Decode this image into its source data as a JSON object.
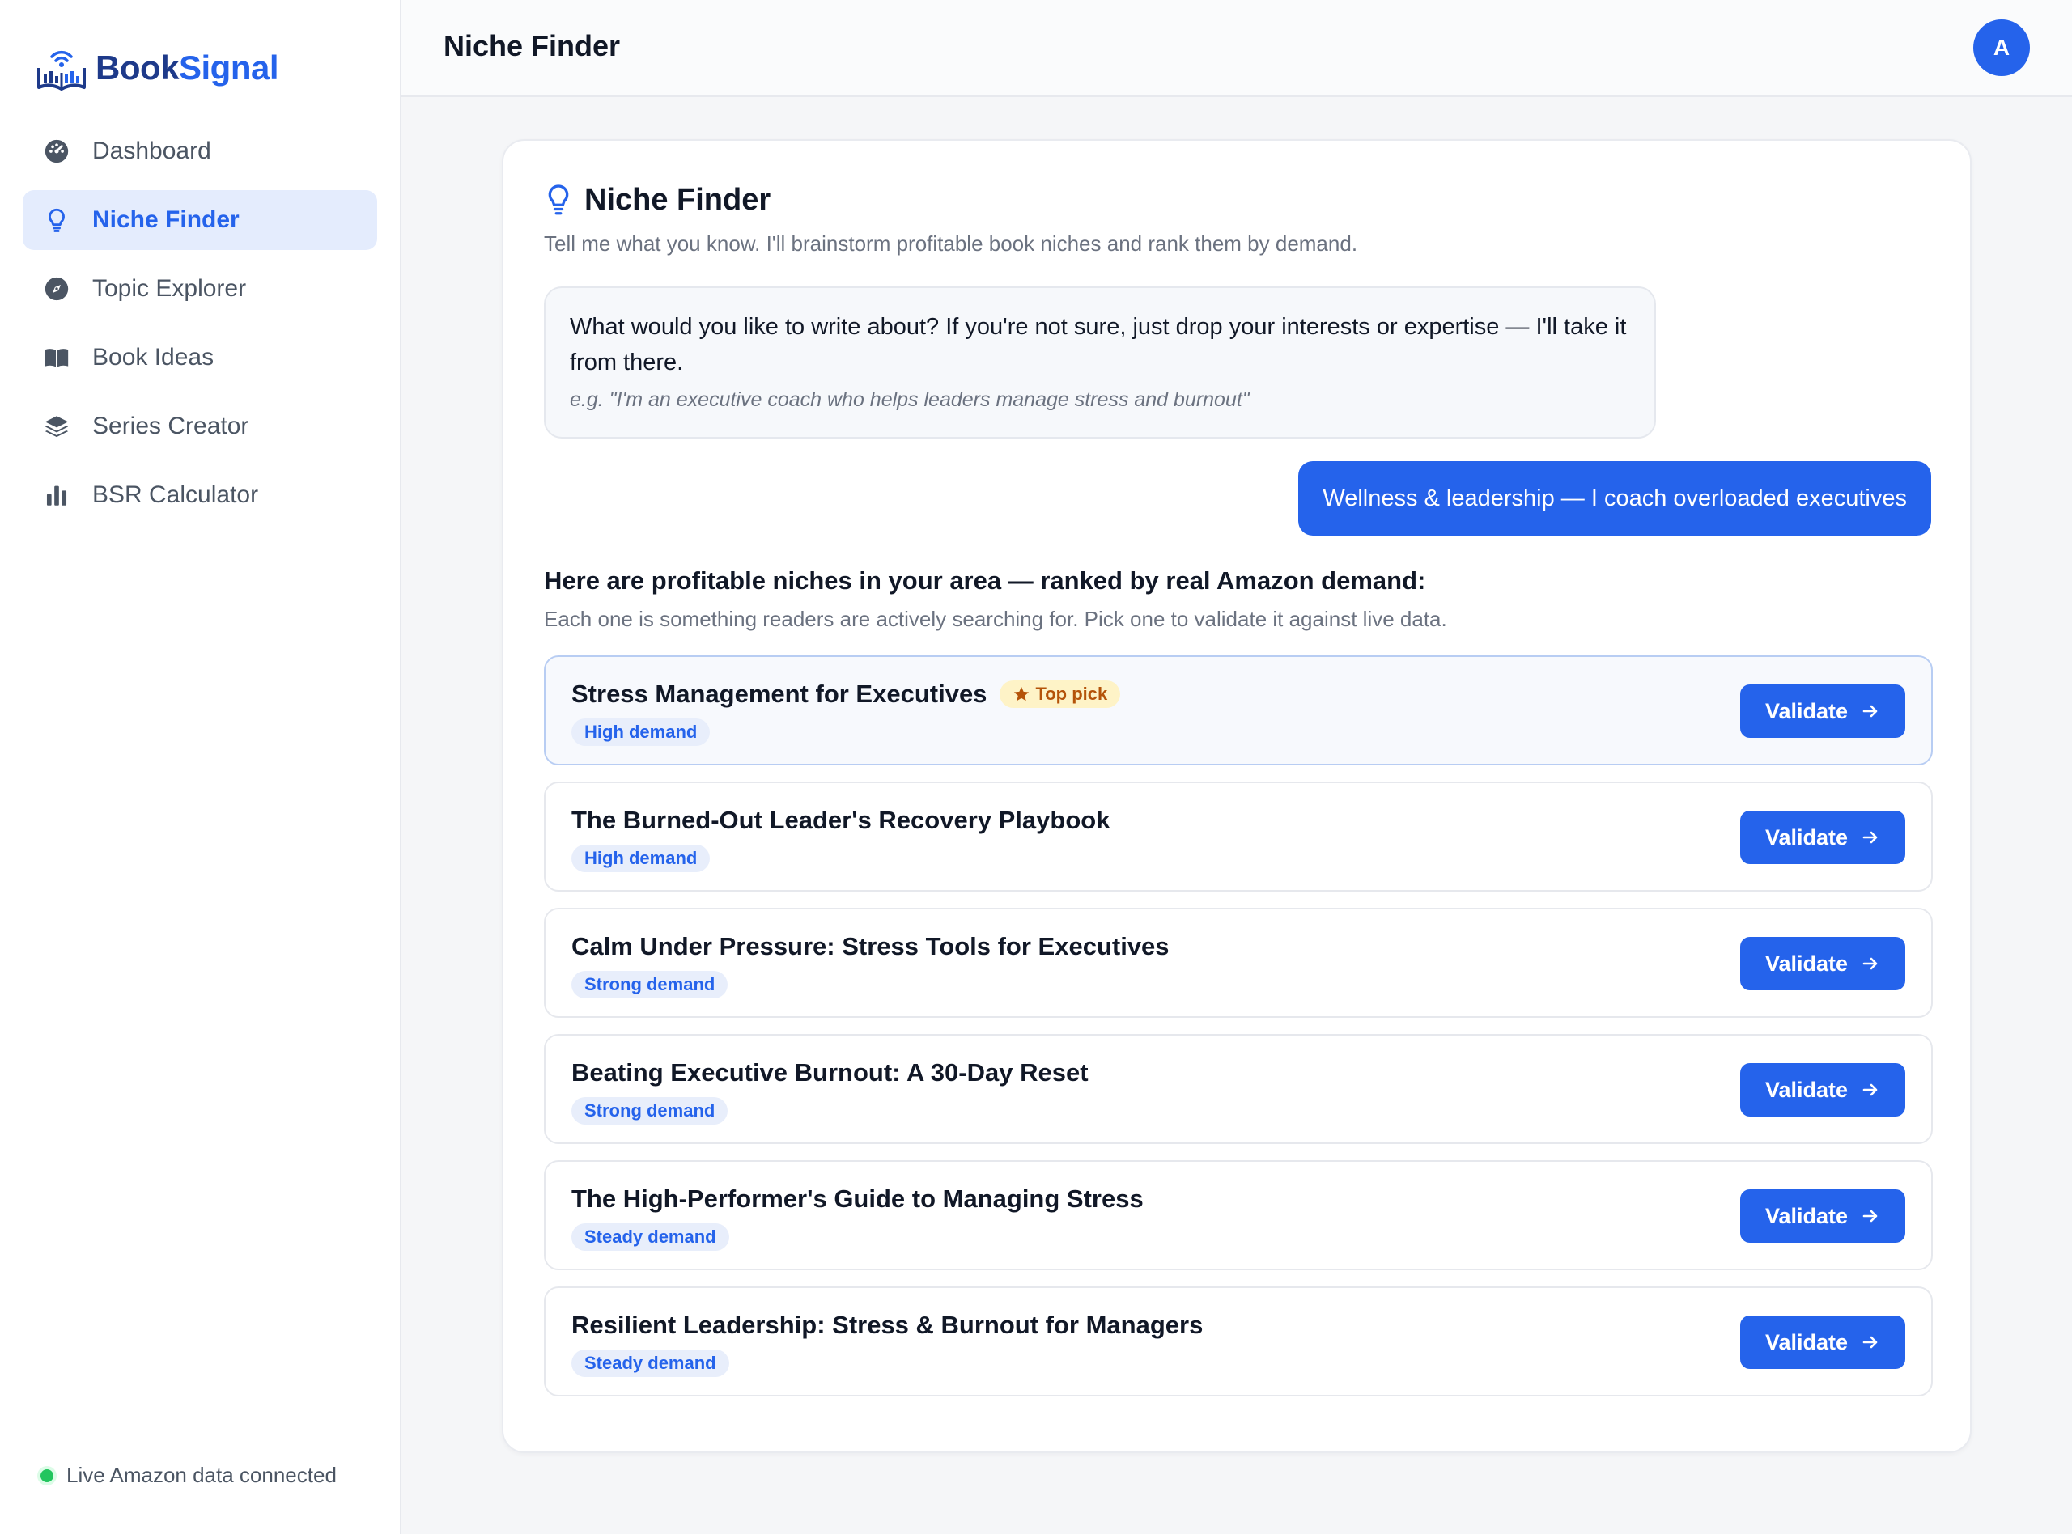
{
  "brand": {
    "part1": "Book",
    "part2": "Signal"
  },
  "sidebar": {
    "items": [
      {
        "label": "Dashboard",
        "icon": "gauge-icon",
        "active": false
      },
      {
        "label": "Niche Finder",
        "icon": "lightbulb-icon",
        "active": true
      },
      {
        "label": "Topic Explorer",
        "icon": "compass-icon",
        "active": false
      },
      {
        "label": "Book Ideas",
        "icon": "open-book-icon",
        "active": false
      },
      {
        "label": "Series Creator",
        "icon": "layers-icon",
        "active": false
      },
      {
        "label": "BSR Calculator",
        "icon": "bar-chart-icon",
        "active": false
      }
    ],
    "status": "Live Amazon data connected"
  },
  "header": {
    "title": "Niche Finder",
    "avatar_initial": "A"
  },
  "card": {
    "title": "Niche Finder",
    "subtitle": "Tell me what you know. I'll brainstorm profitable book niches and rank them by demand.",
    "assistant_message": "What would you like to write about? If you're not sure, just drop your interests or expertise — I'll take it from there.",
    "assistant_example": "e.g. \"I'm an executive coach who helps leaders manage stress and burnout\"",
    "user_message": "Wellness & leadership — I coach overloaded executives",
    "results_title": "Here are profitable niches in your area — ranked by real Amazon demand:",
    "results_subtitle": "Each one is something readers are actively searching for. Pick one to validate it against live data.",
    "top_pick_label": "Top pick",
    "validate_label": "Validate",
    "niches": [
      {
        "title": "Stress Management for Executives",
        "demand": "High demand",
        "top_pick": true
      },
      {
        "title": "The Burned-Out Leader's Recovery Playbook",
        "demand": "High demand",
        "top_pick": false
      },
      {
        "title": "Calm Under Pressure: Stress Tools for Executives",
        "demand": "Strong demand",
        "top_pick": false
      },
      {
        "title": "Beating Executive Burnout: A 30-Day Reset",
        "demand": "Strong demand",
        "top_pick": false
      },
      {
        "title": "The High-Performer's Guide to Managing Stress",
        "demand": "Steady demand",
        "top_pick": false
      },
      {
        "title": "Resilient Leadership: Stress & Burnout for Managers",
        "demand": "Steady demand",
        "top_pick": false
      }
    ]
  },
  "colors": {
    "accent": "#2563eb",
    "brand_dark": "#1e3a8a",
    "status_green": "#22c55e",
    "top_pick_bg": "#fef3c7",
    "top_pick_text": "#b45309"
  }
}
